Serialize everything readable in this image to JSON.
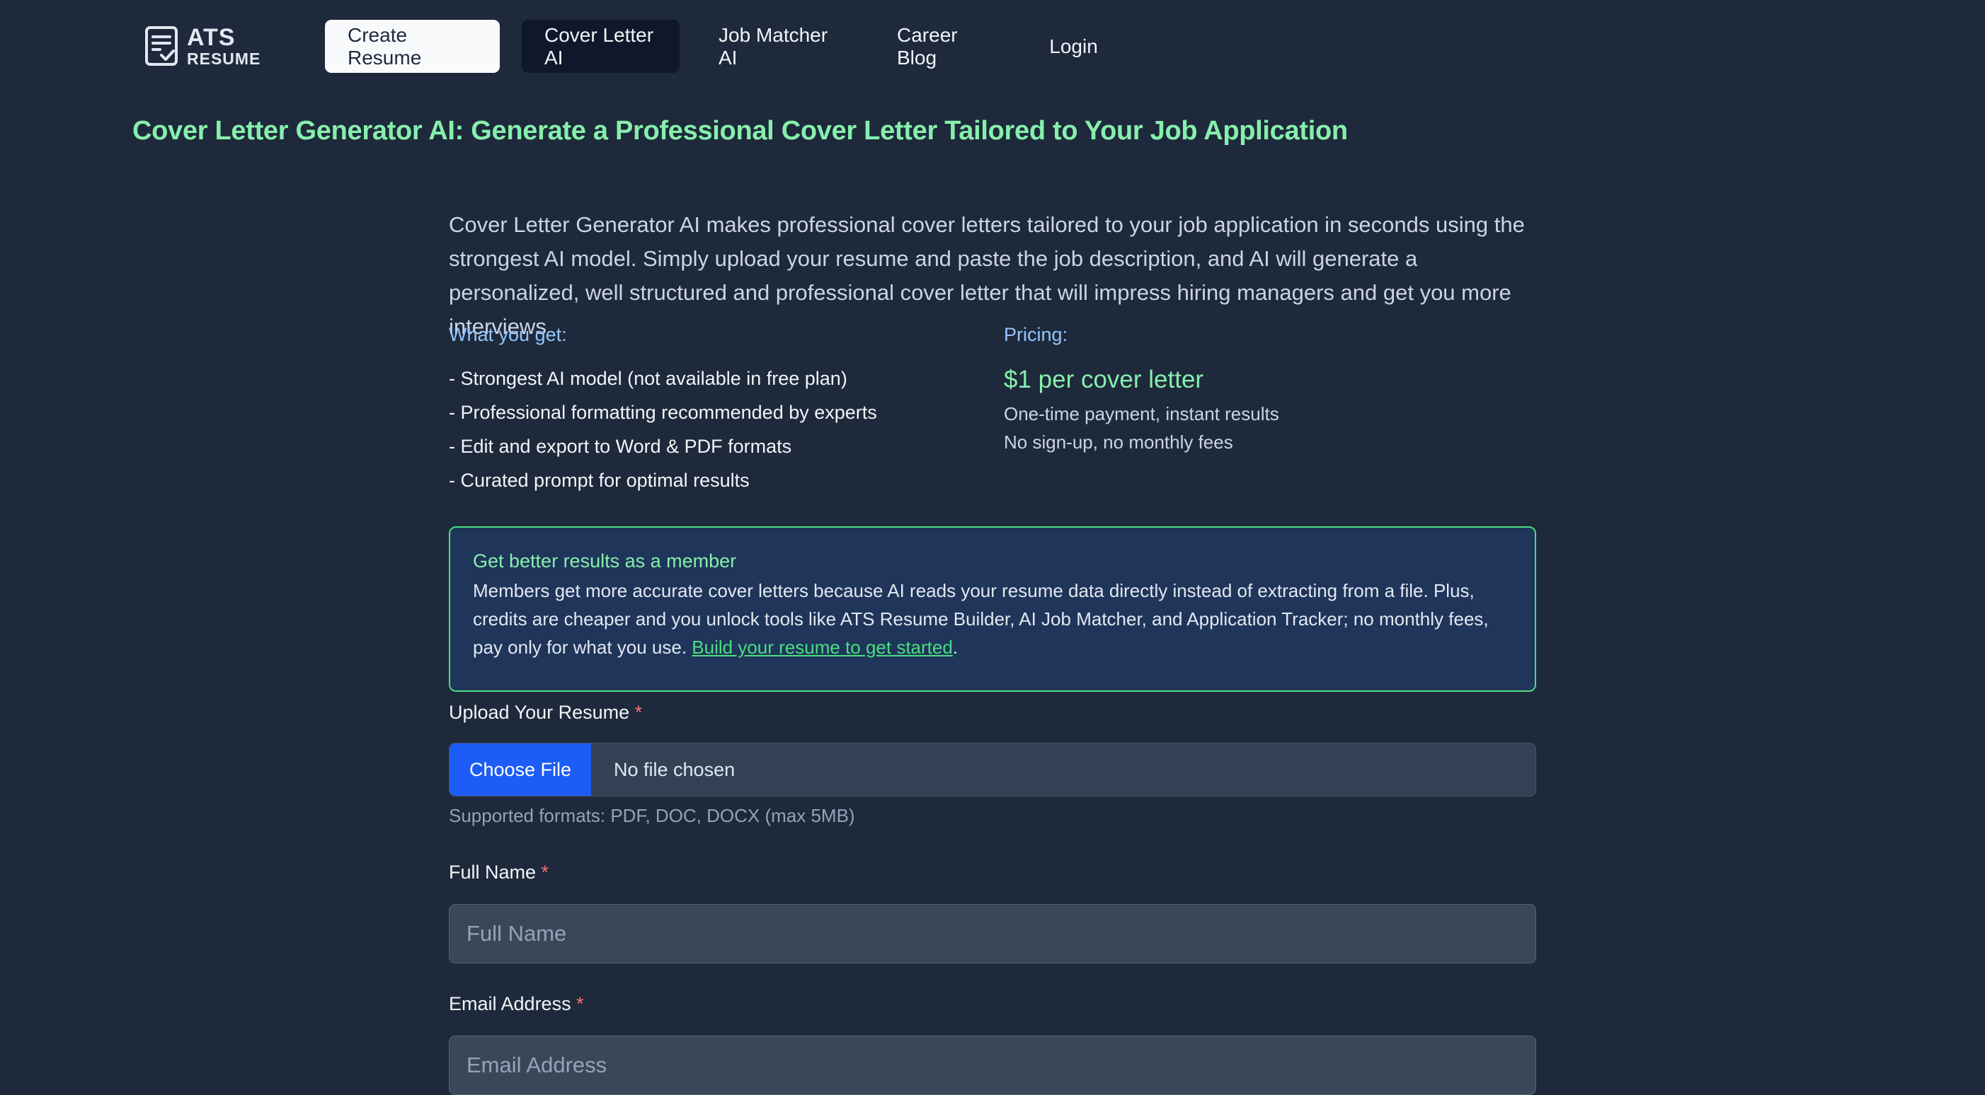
{
  "nav": {
    "logo_top": "ATS",
    "logo_bottom": "RESUME",
    "create_resume": "Create Resume",
    "cover_letter_ai": "Cover Letter AI",
    "job_matcher_ai": "Job Matcher AI",
    "career_blog": "Career Blog",
    "login": "Login"
  },
  "title": "Cover Letter Generator AI: Generate a Professional Cover Letter Tailored to Your Job Application",
  "intro": "Cover Letter Generator AI makes professional cover letters tailored to your job application in seconds using the strongest AI model. Simply upload your resume and paste the job description, and AI will generate a personalized, well structured and professional cover letter that will impress hiring managers and get you more interviews",
  "what_you_get": {
    "label": "What you get:",
    "items": [
      "- Strongest AI model (not available in free plan)",
      "- Professional formatting recommended by experts",
      "- Edit and export to Word & PDF formats",
      "- Curated prompt for optimal results"
    ]
  },
  "pricing": {
    "label": "Pricing:",
    "price": "$1 per cover letter",
    "note1": "One-time payment, instant results",
    "note2": "No sign-up, no monthly fees"
  },
  "member_box": {
    "title": "Get better results as a member",
    "text": "Members get more accurate cover letters because AI reads your resume data directly instead of extracting from a file. Plus, credits are cheaper and you unlock tools like ATS Resume Builder, AI Job Matcher, and Application Tracker; no monthly fees, pay only for what you use.",
    "link": "Build your resume to get started",
    "after_link": "."
  },
  "form": {
    "upload_label": "Upload Your Resume",
    "required_mark": "*",
    "choose_file": "Choose File",
    "file_status": "No file chosen",
    "hint": "Supported formats: PDF, DOC, DOCX (max 5MB)",
    "full_name_label": "Full Name",
    "full_name_placeholder": "Full Name",
    "full_name_value": "",
    "email_label": "Email Address",
    "email_placeholder": "Email Address",
    "email_value": ""
  },
  "colors": {
    "background": "#1e293b",
    "accent_green": "#86efac",
    "accent_blue": "#93c5fd",
    "button_blue": "#1d5cf5",
    "required_red": "#f87171"
  },
  "icons": {
    "logo": "document-check-icon"
  }
}
